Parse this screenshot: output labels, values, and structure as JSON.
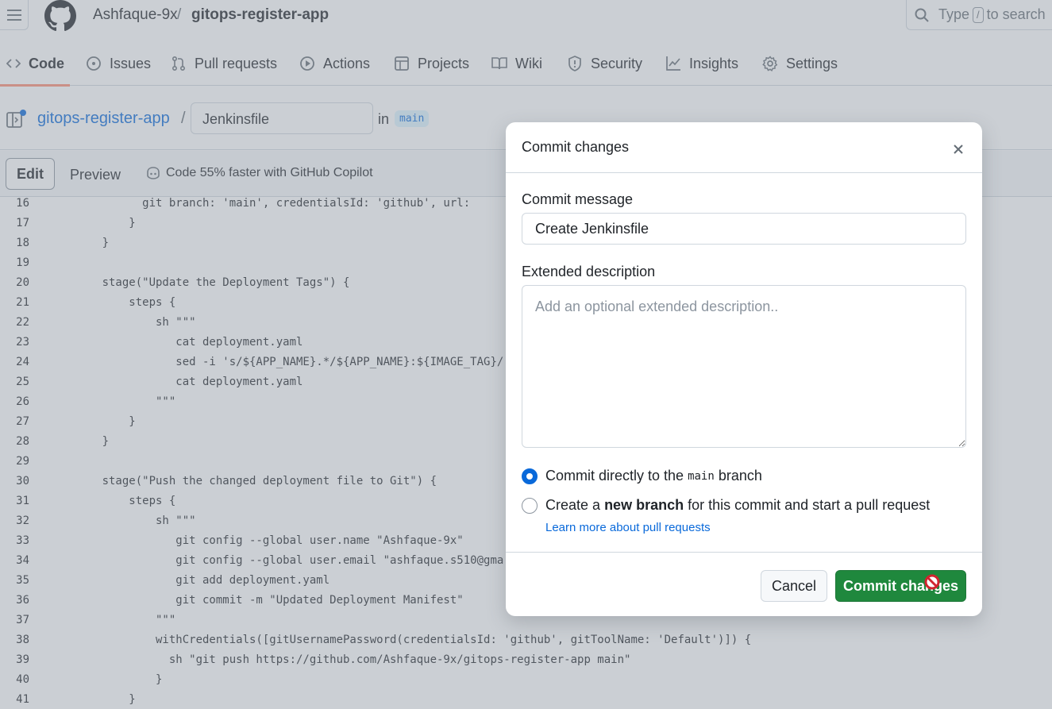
{
  "header": {
    "owner": "Ashfaque-9x",
    "separator": "/",
    "repo": "gitops-register-app",
    "search_prefix": "Type",
    "search_key": "/",
    "search_suffix": "to search"
  },
  "repo_nav": {
    "items": [
      {
        "label": "Code",
        "icon": "code-icon",
        "active": true
      },
      {
        "label": "Issues",
        "icon": "issue-icon"
      },
      {
        "label": "Pull requests",
        "icon": "pull-request-icon"
      },
      {
        "label": "Actions",
        "icon": "play-icon"
      },
      {
        "label": "Projects",
        "icon": "table-icon"
      },
      {
        "label": "Wiki",
        "icon": "book-icon"
      },
      {
        "label": "Security",
        "icon": "shield-icon"
      },
      {
        "label": "Insights",
        "icon": "graph-icon"
      },
      {
        "label": "Settings",
        "icon": "gear-icon"
      }
    ]
  },
  "path": {
    "repo": "gitops-register-app",
    "separator": "/",
    "filename": "Jenkinsfile",
    "in_label": "in",
    "branch": "main"
  },
  "editor_toolbar": {
    "edit": "Edit",
    "preview": "Preview",
    "copilot": "Code 55% faster with GitHub Copilot"
  },
  "code_lines": [
    {
      "n": "16",
      "text": "            git branch: 'main', credentialsId: 'github', url:"
    },
    {
      "n": "17",
      "text": "          }"
    },
    {
      "n": "18",
      "text": "      }"
    },
    {
      "n": "19",
      "text": ""
    },
    {
      "n": "20",
      "text": "      stage(\"Update the Deployment Tags\") {"
    },
    {
      "n": "21",
      "text": "          steps {"
    },
    {
      "n": "22",
      "text": "              sh \"\"\""
    },
    {
      "n": "23",
      "text": "                 cat deployment.yaml"
    },
    {
      "n": "24",
      "text": "                 sed -i 's/${APP_NAME}.*/${APP_NAME}:${IMAGE_TAG}/"
    },
    {
      "n": "25",
      "text": "                 cat deployment.yaml"
    },
    {
      "n": "26",
      "text": "              \"\"\""
    },
    {
      "n": "27",
      "text": "          }"
    },
    {
      "n": "28",
      "text": "      }"
    },
    {
      "n": "29",
      "text": ""
    },
    {
      "n": "30",
      "text": "      stage(\"Push the changed deployment file to Git\") {"
    },
    {
      "n": "31",
      "text": "          steps {"
    },
    {
      "n": "32",
      "text": "              sh \"\"\""
    },
    {
      "n": "33",
      "text": "                 git config --global user.name \"Ashfaque-9x\""
    },
    {
      "n": "34",
      "text": "                 git config --global user.email \"ashfaque.s510@gma"
    },
    {
      "n": "35",
      "text": "                 git add deployment.yaml"
    },
    {
      "n": "36",
      "text": "                 git commit -m \"Updated Deployment Manifest\""
    },
    {
      "n": "37",
      "text": "              \"\"\""
    },
    {
      "n": "38",
      "text": "              withCredentials([gitUsernamePassword(credentialsId: 'github', gitToolName: 'Default')]) {"
    },
    {
      "n": "39",
      "text": "                sh \"git push https://github.com/Ashfaque-9x/gitops-register-app main\""
    },
    {
      "n": "40",
      "text": "              }"
    },
    {
      "n": "41",
      "text": "          }"
    }
  ],
  "dialog": {
    "title": "Commit changes",
    "commit_message_label": "Commit message",
    "commit_message_value": "Create Jenkinsfile",
    "extended_label": "Extended description",
    "extended_placeholder": "Add an optional extended description..",
    "option_direct_prefix": "Commit directly to the",
    "option_direct_branch": "main",
    "option_direct_suffix": "branch",
    "option_new_prefix": "Create a",
    "option_new_bold": "new branch",
    "option_new_suffix": "for this commit and start a pull request",
    "learn_more": "Learn more about pull requests",
    "cancel": "Cancel",
    "commit": "Commit changes",
    "selected_option": "direct"
  },
  "colors": {
    "link": "#0969da",
    "commit_button": "#1f883d",
    "active_tab_underline": "#fd8c73"
  }
}
